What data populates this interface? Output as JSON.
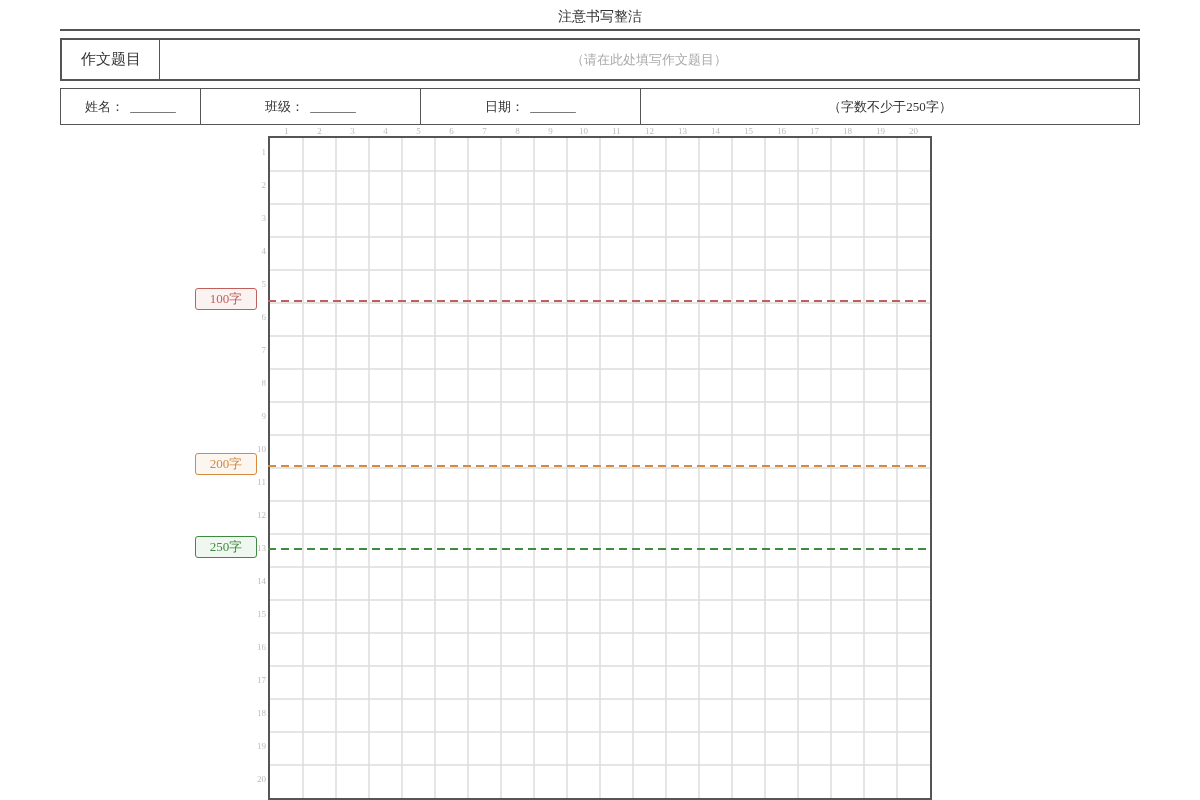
{
  "header": {
    "title": "注意书写整洁"
  },
  "topic": {
    "label": "作文题目",
    "placeholder": "（请在此处填写作文题目）"
  },
  "info_fields": [
    {
      "label": "姓名：",
      "blank": "_______"
    },
    {
      "label": "班级：",
      "blank": "_______"
    },
    {
      "label": "日期：",
      "blank": "_______"
    }
  ],
  "requirement": "（字数不少于250字）",
  "grid": {
    "column_numbers": [
      "1",
      "2",
      "3",
      "4",
      "5",
      "6",
      "7",
      "8",
      "9",
      "10",
      "11",
      "12",
      "13",
      "14",
      "15",
      "16",
      "17",
      "18",
      "19",
      "20"
    ],
    "rows": [
      {
        "number": "1"
      },
      {
        "number": "2"
      },
      {
        "number": "3"
      },
      {
        "number": "4"
      },
      {
        "number": "5",
        "marker": {
          "label": "100字",
          "color": "#c0605c",
          "kind": "edge"
        }
      },
      {
        "number": "6"
      },
      {
        "number": "7"
      },
      {
        "number": "8"
      },
      {
        "number": "9"
      },
      {
        "number": "10",
        "marker": {
          "label": "200字",
          "color": "#d48a40",
          "kind": "edge"
        }
      },
      {
        "number": "11"
      },
      {
        "number": "12"
      },
      {
        "number": "13",
        "marker": {
          "label": "250字",
          "color": "#3f8a3f",
          "kind": "middle"
        }
      },
      {
        "number": "14"
      },
      {
        "number": "15"
      },
      {
        "number": "16"
      },
      {
        "number": "17"
      },
      {
        "number": "18"
      },
      {
        "number": "19"
      },
      {
        "number": "20"
      }
    ]
  }
}
